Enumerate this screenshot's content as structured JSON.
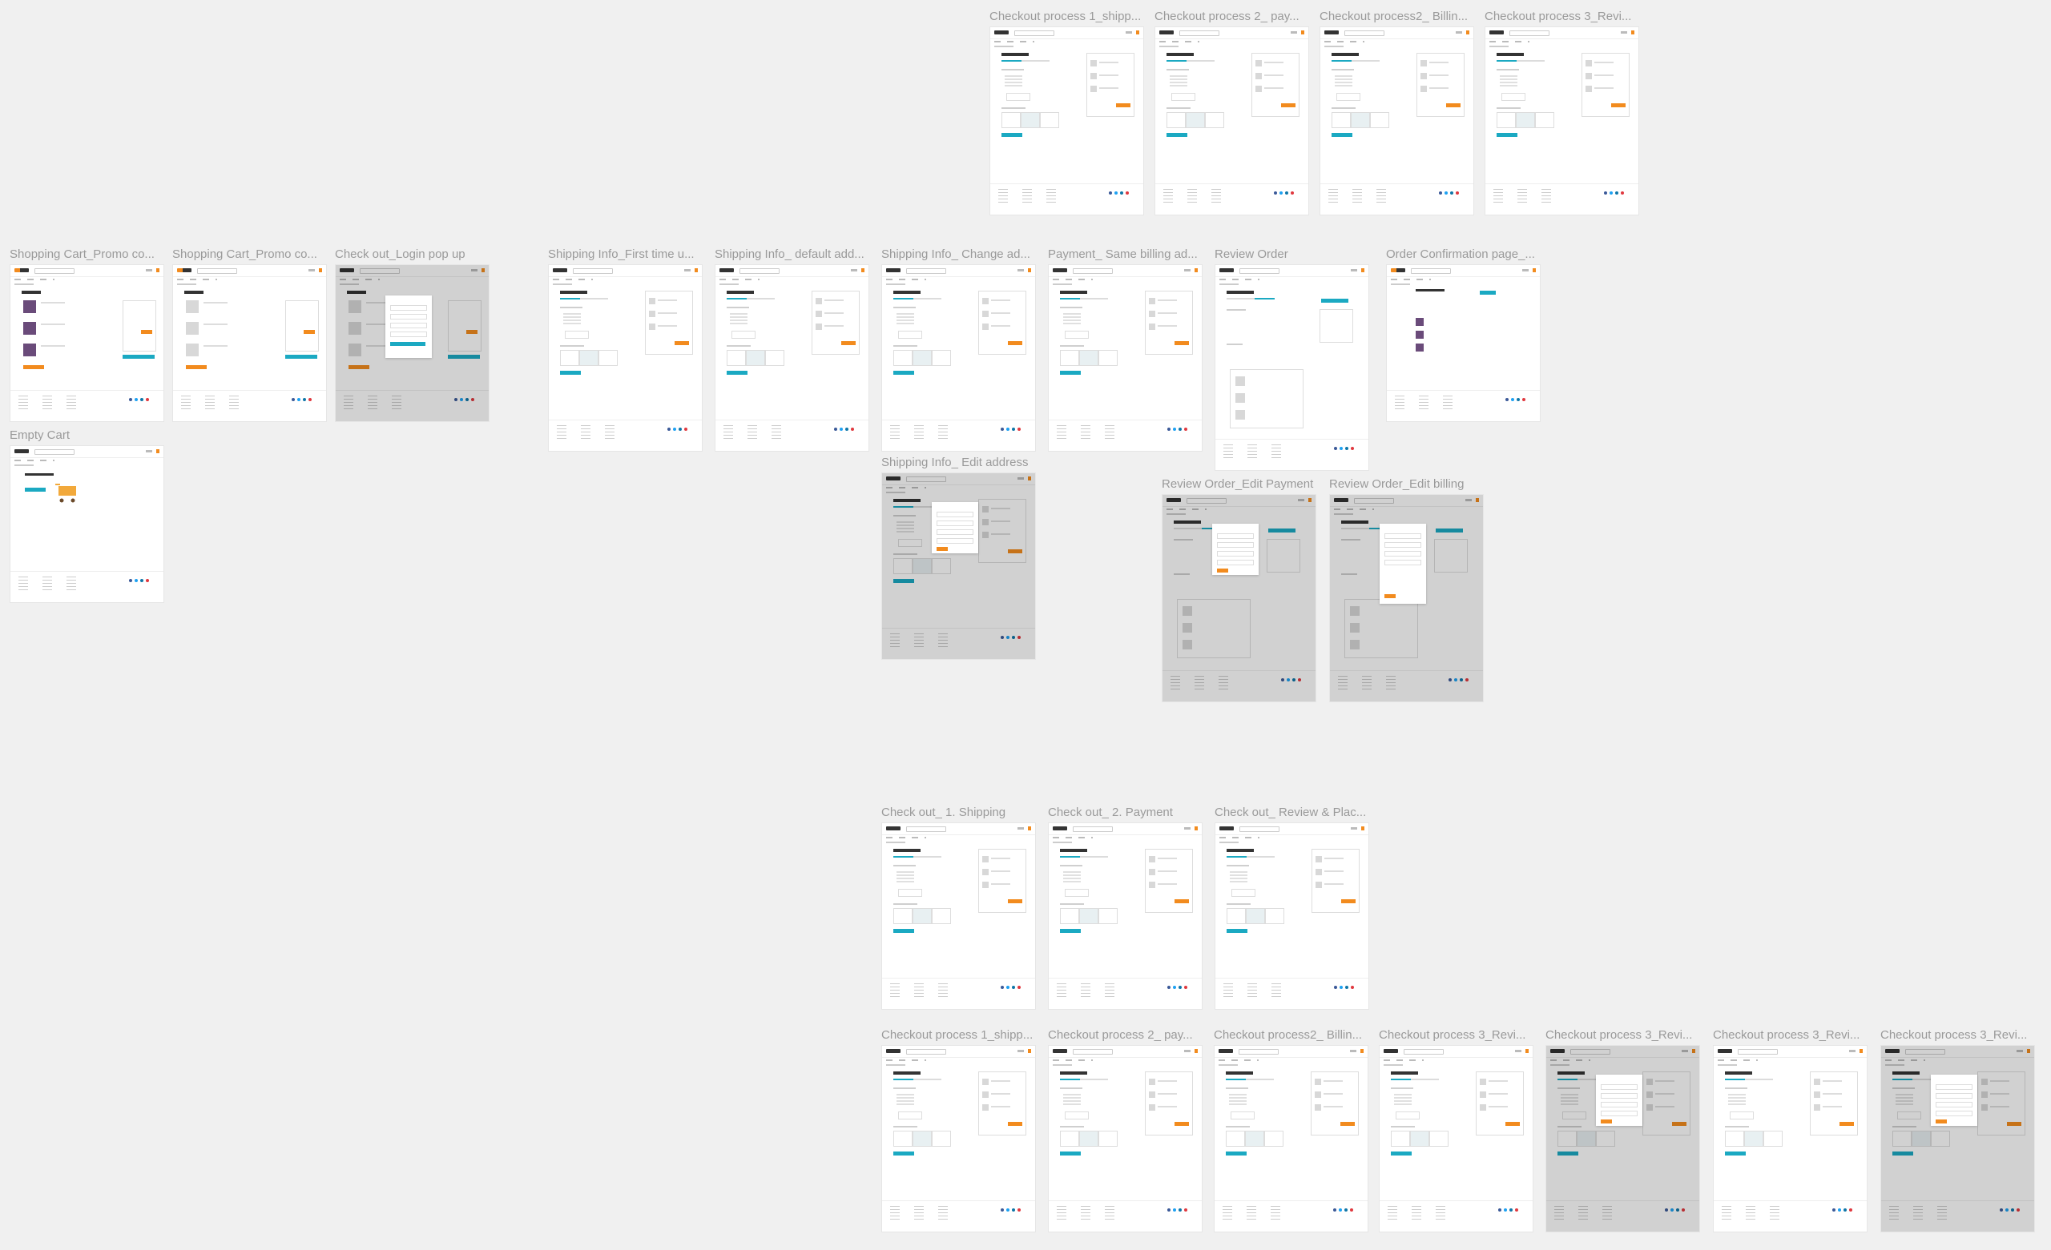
{
  "canvas": {
    "background_color": "#f0f0f0",
    "brand_colors": {
      "teal": "#1ba9c2",
      "orange": "#f28b1e"
    },
    "frames": [
      {
        "id": "f1",
        "title": "Checkout process 1_shipp...",
        "variant": "checkout",
        "dim": false
      },
      {
        "id": "f2",
        "title": "Checkout process 2_ pay...",
        "variant": "checkout",
        "dim": false
      },
      {
        "id": "f3",
        "title": "Checkout process2_ Billin...",
        "variant": "checkout",
        "dim": false
      },
      {
        "id": "f4",
        "title": "Checkout process 3_Revi...",
        "variant": "checkout",
        "dim": false
      },
      {
        "id": "f5",
        "title": "Shopping Cart_Promo co...",
        "variant": "cart",
        "dim": false
      },
      {
        "id": "f6",
        "title": "Shopping Cart_Promo co...",
        "variant": "cart",
        "dim": false
      },
      {
        "id": "f7",
        "title": "Check out_Login pop up",
        "variant": "cart-modal",
        "dim": true
      },
      {
        "id": "f8",
        "title": "Empty Cart",
        "variant": "empty",
        "dim": false
      },
      {
        "id": "f9",
        "title": "Shipping Info_First time u...",
        "variant": "checkout",
        "dim": false
      },
      {
        "id": "f10",
        "title": "Shipping Info_ default add...",
        "variant": "checkout",
        "dim": false
      },
      {
        "id": "f11",
        "title": "Shipping Info_ Change ad...",
        "variant": "checkout",
        "dim": false
      },
      {
        "id": "f12",
        "title": "Payment_ Same billing ad...",
        "variant": "checkout",
        "dim": false
      },
      {
        "id": "f13",
        "title": "Review Order",
        "variant": "review",
        "dim": false
      },
      {
        "id": "f14",
        "title": "Order Confirmation page_...",
        "variant": "confirm",
        "dim": false
      },
      {
        "id": "f15",
        "title": "Shipping Info_ Edit address",
        "variant": "checkout-modal",
        "dim": true
      },
      {
        "id": "f16",
        "title": "Review Order_Edit Payment",
        "variant": "review-modal",
        "dim": true
      },
      {
        "id": "f17",
        "title": "Review Order_Edit billing",
        "variant": "review-modal-tall",
        "dim": true
      },
      {
        "id": "f18",
        "title": "Check out_ 1. Shipping",
        "variant": "checkout",
        "dim": false
      },
      {
        "id": "f19",
        "title": "Check out_ 2. Payment",
        "variant": "checkout",
        "dim": false
      },
      {
        "id": "f20",
        "title": "Check out_ Review & Plac...",
        "variant": "checkout",
        "dim": false
      },
      {
        "id": "f21",
        "title": "Checkout process 1_shipp...",
        "variant": "checkout",
        "dim": false
      },
      {
        "id": "f22",
        "title": "Checkout process 2_ pay...",
        "variant": "checkout",
        "dim": false
      },
      {
        "id": "f23",
        "title": "Checkout process2_ Billin...",
        "variant": "checkout",
        "dim": false
      },
      {
        "id": "f24",
        "title": "Checkout process 3_Revi...",
        "variant": "checkout",
        "dim": false
      },
      {
        "id": "f25",
        "title": "Checkout process 3_Revi...",
        "variant": "checkout-modal",
        "dim": true
      },
      {
        "id": "f26",
        "title": "Checkout process 3_Revi...",
        "variant": "checkout",
        "dim": false
      },
      {
        "id": "f27",
        "title": "Checkout process 3_Revi...",
        "variant": "checkout-modal",
        "dim": true
      }
    ]
  }
}
